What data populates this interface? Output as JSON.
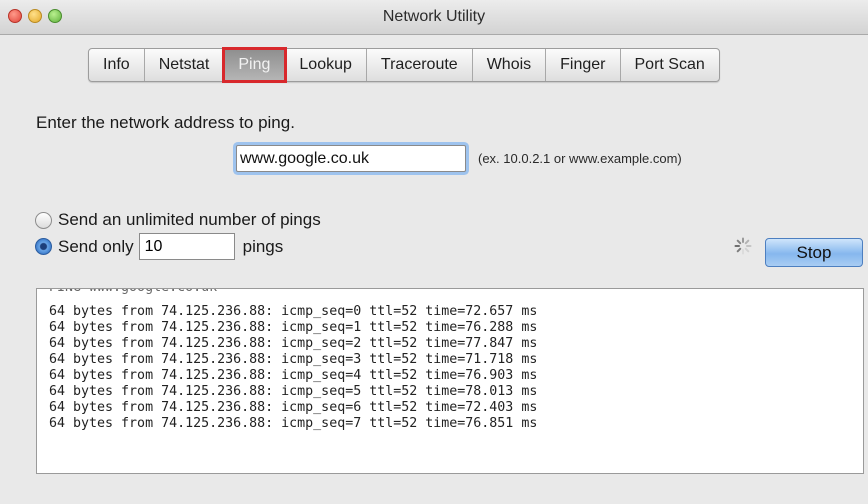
{
  "window": {
    "title": "Network Utility"
  },
  "tabs": [
    {
      "label": "Info"
    },
    {
      "label": "Netstat"
    },
    {
      "label": "Ping"
    },
    {
      "label": "Lookup"
    },
    {
      "label": "Traceroute"
    },
    {
      "label": "Whois"
    },
    {
      "label": "Finger"
    },
    {
      "label": "Port Scan"
    }
  ],
  "selected_tab": "Ping",
  "ping": {
    "prompt": "Enter the network address to ping.",
    "address_value": "www.google.co.uk",
    "example_hint": "(ex. 10.0.2.1 or www.example.com)",
    "option_unlimited": "Send an unlimited number of pings",
    "option_only": "Send only",
    "count_value": "10",
    "pings_suffix": "pings",
    "stop_label": "Stop"
  },
  "output": {
    "lines": [
      "64 bytes from 74.125.236.88: icmp_seq=0 ttl=52 time=72.657 ms",
      "64 bytes from 74.125.236.88: icmp_seq=1 ttl=52 time=76.288 ms",
      "64 bytes from 74.125.236.88: icmp_seq=2 ttl=52 time=77.847 ms",
      "64 bytes from 74.125.236.88: icmp_seq=3 ttl=52 time=71.718 ms",
      "64 bytes from 74.125.236.88: icmp_seq=4 ttl=52 time=76.903 ms",
      "64 bytes from 74.125.236.88: icmp_seq=5 ttl=52 time=78.013 ms",
      "64 bytes from 74.125.236.88: icmp_seq=6 ttl=52 time=72.403 ms",
      "64 bytes from 74.125.236.88: icmp_seq=7 ttl=52 time=76.851 ms"
    ]
  },
  "colors": {
    "highlight": "#d8282c",
    "accent": "#86b7ee"
  }
}
